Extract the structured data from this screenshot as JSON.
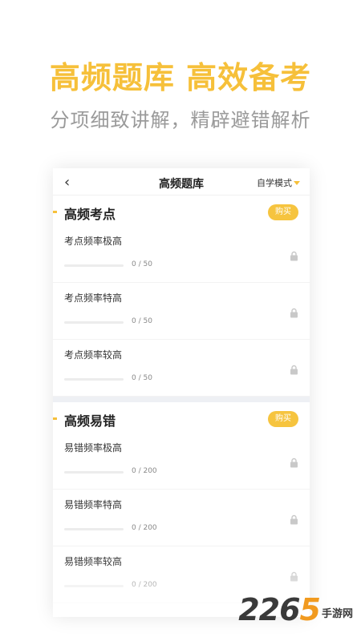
{
  "promo": {
    "headline": "高频题库 高效备考",
    "subline": "分项细致讲解，精辟避错解析"
  },
  "navbar": {
    "back_icon": "chevron-left-icon",
    "title": "高频题库",
    "mode_label": "自学模式"
  },
  "sections": [
    {
      "title": "高频考点",
      "buy_label": "购买",
      "items": [
        {
          "title": "考点频率极高",
          "progress_text": "0 / 50",
          "progress": 0
        },
        {
          "title": "考点频率特高",
          "progress_text": "0 / 50",
          "progress": 0
        },
        {
          "title": "考点频率较高",
          "progress_text": "0 / 50",
          "progress": 0
        }
      ]
    },
    {
      "title": "高频易错",
      "buy_label": "购买",
      "items": [
        {
          "title": "易错频率极高",
          "progress_text": "0 / 200",
          "progress": 0
        },
        {
          "title": "易错频率特高",
          "progress_text": "0 / 200",
          "progress": 0
        },
        {
          "title": "易错频率较高",
          "progress_text": "0 / 200",
          "progress": 0
        }
      ]
    }
  ],
  "watermark": {
    "number_a": "22",
    "number_b": "6",
    "number_c": "5",
    "text": "手游网"
  },
  "colors": {
    "accent": "#f6c03a",
    "subtle_text": "#9a9a9a",
    "divider": "#eef0f4"
  }
}
